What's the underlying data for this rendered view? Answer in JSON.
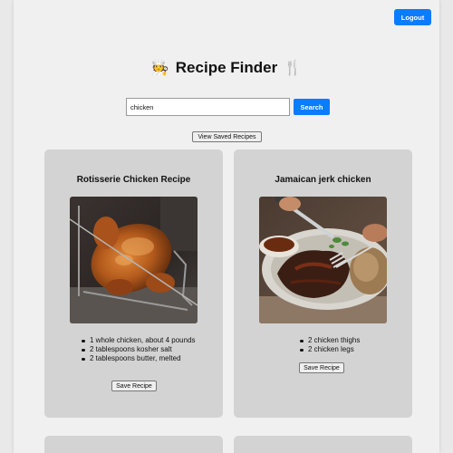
{
  "header": {
    "logout_label": "Logout",
    "title": "Recipe Finder",
    "title_left_emoji": "🧑‍🍳",
    "title_right_emoji": "🍴"
  },
  "search": {
    "value": "chicken",
    "button_label": "Search"
  },
  "saved_button_label": "View Saved Recipes",
  "colors": {
    "accent": "#0a7cff",
    "card_bg": "#d3d3d3",
    "page_bg": "#f0f0f0"
  },
  "recipes": [
    {
      "title": "Rotisserie Chicken Recipe",
      "image": "roast-chicken-photo",
      "ingredients": [
        "1 whole chicken, about 4 pounds",
        "2 tablespoons kosher salt",
        "2 tablespoons butter, melted"
      ],
      "save_label": "Save Recipe"
    },
    {
      "title": "Jamaican jerk chicken",
      "image": "jerk-chicken-photo",
      "ingredients": [
        "2 chicken thighs",
        "2 chicken legs"
      ],
      "save_label": "Save Recipe"
    }
  ]
}
